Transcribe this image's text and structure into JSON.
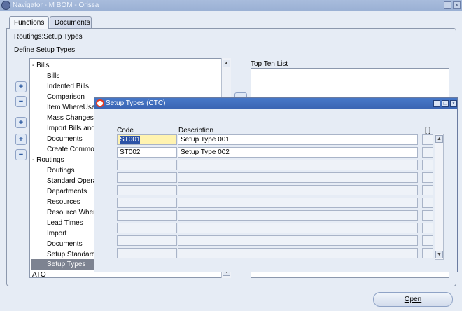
{
  "navigator": {
    "title": "Navigator - M BOM - Orissa",
    "tabs": [
      {
        "label": "Functions",
        "active": true
      },
      {
        "label": "Documents",
        "active": false
      }
    ],
    "breadcrumb": "Routings:Setup Types",
    "section_label": "Define Setup Types",
    "top_ten_label": "Top Ten List",
    "open_button": "Open"
  },
  "tree": {
    "items": [
      {
        "label": "- Bills",
        "level": 0
      },
      {
        "label": "Bills",
        "level": 1
      },
      {
        "label": "Indented Bills",
        "level": 1
      },
      {
        "label": "Comparison",
        "level": 1
      },
      {
        "label": "Item WhereUse",
        "level": 1
      },
      {
        "label": "Mass Changes",
        "level": 1
      },
      {
        "label": "Import Bills and",
        "level": 1
      },
      {
        "label": "Documents",
        "level": 1
      },
      {
        "label": "Create Commo",
        "level": 1
      },
      {
        "label": "- Routings",
        "level": 0
      },
      {
        "label": "Routings",
        "level": 1
      },
      {
        "label": "Standard Opera",
        "level": 1
      },
      {
        "label": "Departments",
        "level": 1
      },
      {
        "label": "Resources",
        "level": 1
      },
      {
        "label": "Resource Wher",
        "level": 1
      },
      {
        "label": "Lead Times",
        "level": 1
      },
      {
        "label": "Import",
        "level": 1
      },
      {
        "label": "Documents",
        "level": 1
      },
      {
        "label": "Setup Standard",
        "level": 1
      },
      {
        "label": "Setup Types",
        "level": 1,
        "selected": true
      },
      {
        "label": "ATO",
        "level": 0
      }
    ],
    "side_buttons": [
      {
        "icon": "expand-icon",
        "glyph": "+"
      },
      {
        "icon": "collapse-icon",
        "glyph": "−"
      },
      {
        "icon": "expand-branch-icon",
        "glyph": "+"
      },
      {
        "icon": "expand-all-icon",
        "glyph": "+"
      },
      {
        "icon": "collapse-all-icon",
        "glyph": "−"
      }
    ]
  },
  "dialog": {
    "title": "Setup Types (CTC)",
    "columns": {
      "code": "Code",
      "description": "Description",
      "flex": "[ ]"
    },
    "rows": [
      {
        "code": "ST001",
        "description": "Setup Type 001"
      },
      {
        "code": "ST002",
        "description": "Setup Type 002"
      },
      {
        "code": "",
        "description": ""
      },
      {
        "code": "",
        "description": ""
      },
      {
        "code": "",
        "description": ""
      },
      {
        "code": "",
        "description": ""
      },
      {
        "code": "",
        "description": ""
      },
      {
        "code": "",
        "description": ""
      },
      {
        "code": "",
        "description": ""
      },
      {
        "code": "",
        "description": ""
      }
    ]
  },
  "colors": {
    "background": "#e6ecf5",
    "dialog_title": "#3a64b2",
    "selected_tree_row": "#7d8391",
    "current_cell": "#fff3b0",
    "text_highlight": "#2b52a6"
  }
}
